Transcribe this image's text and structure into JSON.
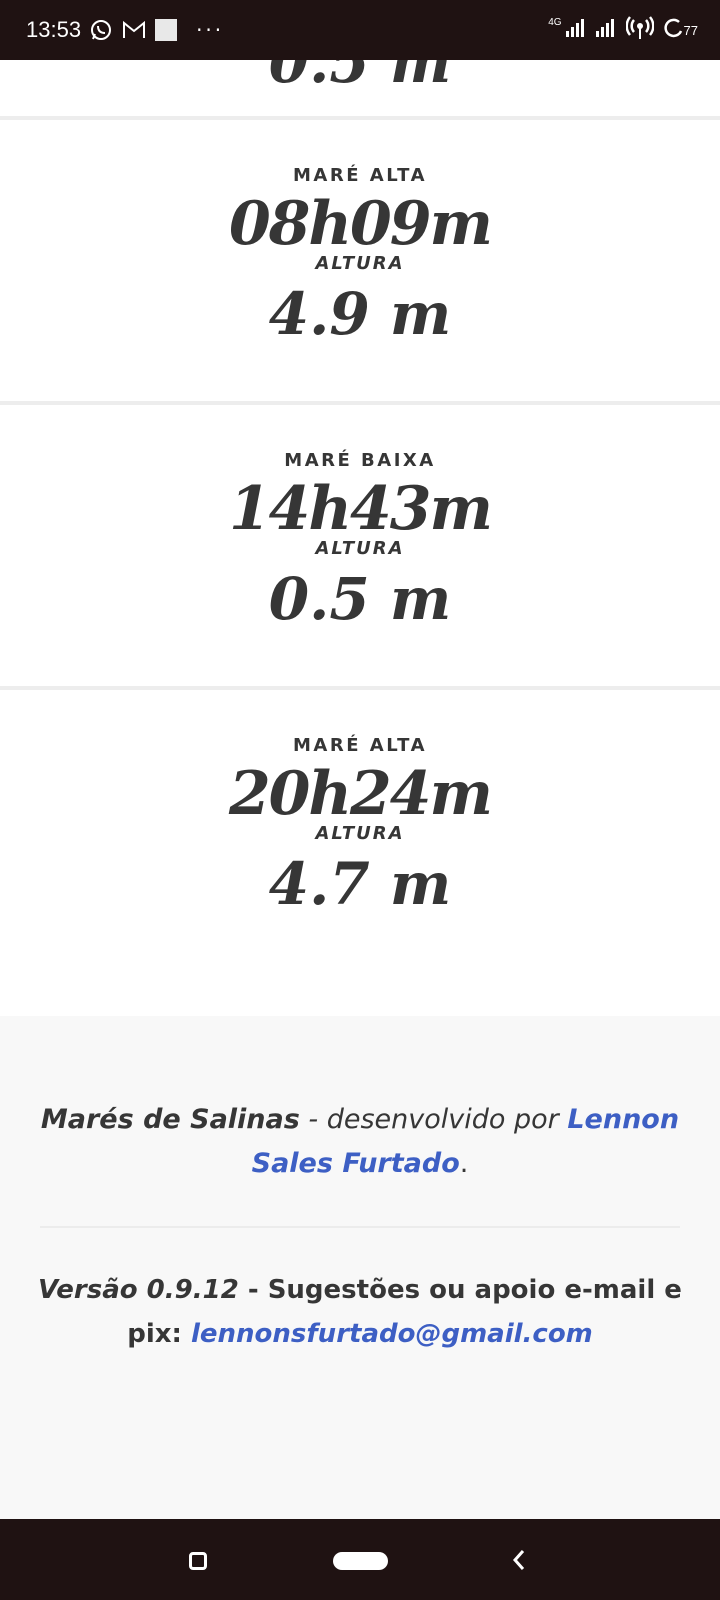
{
  "status_bar": {
    "time": "13:53",
    "network_label": "4G",
    "battery": "77",
    "icons": [
      "whatsapp-icon",
      "gmail-icon",
      "notification-square-icon",
      "more-dots-icon",
      "signal-icon",
      "signal-icon",
      "hotspot-icon",
      "battery-icon"
    ]
  },
  "cut_card": {
    "value": "0.5 m"
  },
  "tides": [
    {
      "label": "MARÉ ALTA",
      "time": "08h09m",
      "height_label": "ALTURA",
      "height": "4.9 m"
    },
    {
      "label": "MARÉ BAIXA",
      "time": "14h43m",
      "height_label": "ALTURA",
      "height": "0.5 m"
    },
    {
      "label": "MARÉ ALTA",
      "time": "20h24m",
      "height_label": "ALTURA",
      "height": "4.7 m"
    }
  ],
  "footer": {
    "app_name": "Marés de Salinas",
    "developed_by": " - desenvolvido por ",
    "author": "Lennon Sales Furtado",
    "period": ".",
    "version": "Versão 0.9.12",
    "contact_text": " - Sugestões ou apoio e-mail e pix: ",
    "email": "lennonsfurtado@gmail.com",
    "link_color": "#3d5fc4"
  },
  "nav_bar": {
    "icons": [
      "recents-icon",
      "home-pill-icon",
      "back-icon"
    ]
  }
}
